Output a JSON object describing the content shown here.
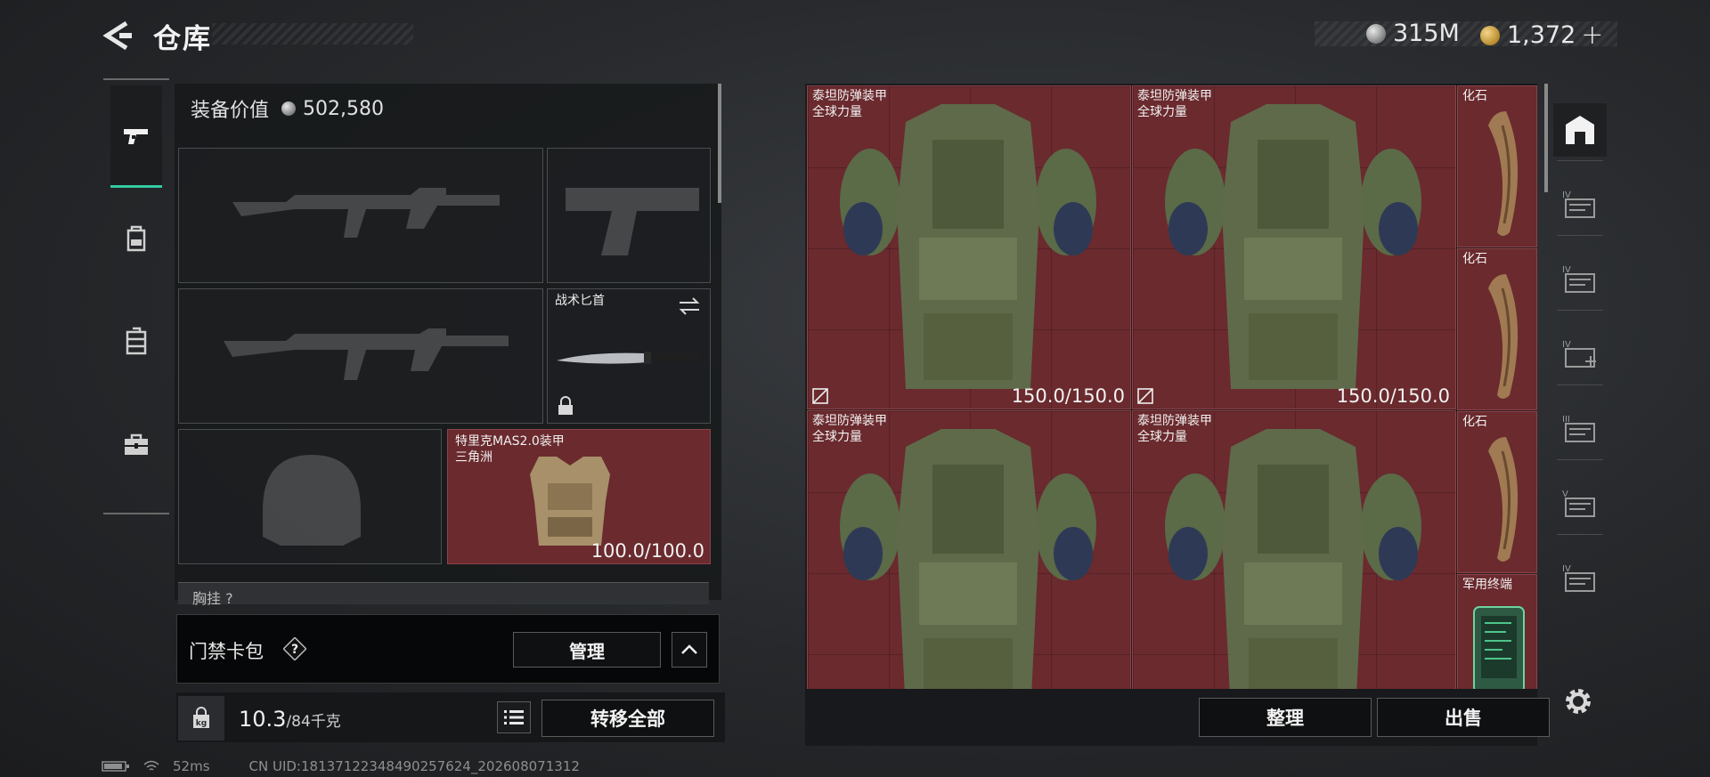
{
  "header": {
    "title": "仓库",
    "currency": [
      {
        "icon": "silver-coin-icon",
        "amount": "315M"
      },
      {
        "icon": "gold-coin-icon",
        "amount": "1,372"
      }
    ],
    "add_label": "+"
  },
  "left_tabs": [
    {
      "name": "weapons",
      "icon": "pistol-icon",
      "active": true
    },
    {
      "name": "gear",
      "icon": "backpack-icon",
      "active": false
    },
    {
      "name": "containers",
      "icon": "locker-icon",
      "active": false
    },
    {
      "name": "supplies",
      "icon": "briefcase-icon",
      "active": false
    }
  ],
  "equipment": {
    "value_label": "装备价值",
    "value": "502,580",
    "melee": {
      "name": "战术匕首"
    },
    "armor": {
      "name": "特里克MAS2.0装甲",
      "subtitle": "三角洲",
      "durability": "100.0/100.0"
    },
    "chest_rig_peek": "胸挂 ?"
  },
  "keycard": {
    "label": "门禁卡包",
    "help": "?",
    "manage_label": "管理"
  },
  "footer_left": {
    "weight_current": "10.3",
    "weight_max": "/84千克",
    "transfer_label": "转移全部"
  },
  "storage": {
    "items": [
      {
        "name": "泰坦防弹装甲",
        "subtitle": "全球力量",
        "durability": "150.0/150.0"
      },
      {
        "name": "泰坦防弹装甲",
        "subtitle": "全球力量",
        "durability": "150.0/150.0"
      },
      {
        "name": "泰坦防弹装甲",
        "subtitle": "全球力量",
        "durability": ""
      },
      {
        "name": "泰坦防弹装甲",
        "subtitle": "全球力量",
        "durability": ""
      },
      {
        "name": "化石"
      },
      {
        "name": "化石"
      },
      {
        "name": "化石"
      },
      {
        "name": "军用终端"
      }
    ],
    "sort_label": "整理",
    "sell_label": "出售"
  },
  "rail": [
    {
      "icon": "home-storage-icon",
      "tier": ""
    },
    {
      "icon": "storage-box-icon",
      "tier": "IV"
    },
    {
      "icon": "storage-box-icon",
      "tier": "IV"
    },
    {
      "icon": "storage-box-icon",
      "tier": "IV"
    },
    {
      "icon": "storage-box-icon",
      "tier": "III"
    },
    {
      "icon": "storage-box-icon",
      "tier": "V"
    },
    {
      "icon": "storage-box-icon",
      "tier": "IV"
    }
  ],
  "status_bar": {
    "ping": "52ms",
    "uid": "CN UID:1813712234849025762​4_202608071312"
  },
  "colors": {
    "accent": "#33c9a0",
    "item_bg": "#6a2a2e"
  }
}
